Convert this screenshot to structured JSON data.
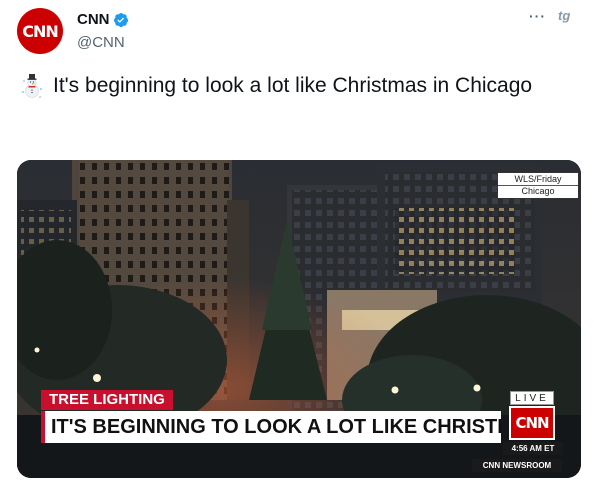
{
  "tweet": {
    "author": {
      "display_name": "CNN",
      "handle": "@CNN",
      "avatar_text": "CNN",
      "verified": true
    },
    "more_label": "···",
    "brand_mark": "tg",
    "text": "It's beginning to look a lot like Christmas in Chicago",
    "emoji": "snowman-icon"
  },
  "media": {
    "corner_credit_line1": "WLS/Friday",
    "corner_credit_line2": "Chicago",
    "lower_third": {
      "tag": "TREE LIGHTING",
      "headline": "IT'S BEGINNING TO LOOK A LOT LIKE CHRISTMAS",
      "live": "LIVE",
      "network_logo": "CNN",
      "time": "4:56 AM ET",
      "program": "CNN NEWSROOM"
    }
  },
  "colors": {
    "cnn_red": "#cc0000",
    "verified_blue": "#1d9bf0",
    "text_primary": "#0f1419",
    "text_secondary": "#536471"
  }
}
